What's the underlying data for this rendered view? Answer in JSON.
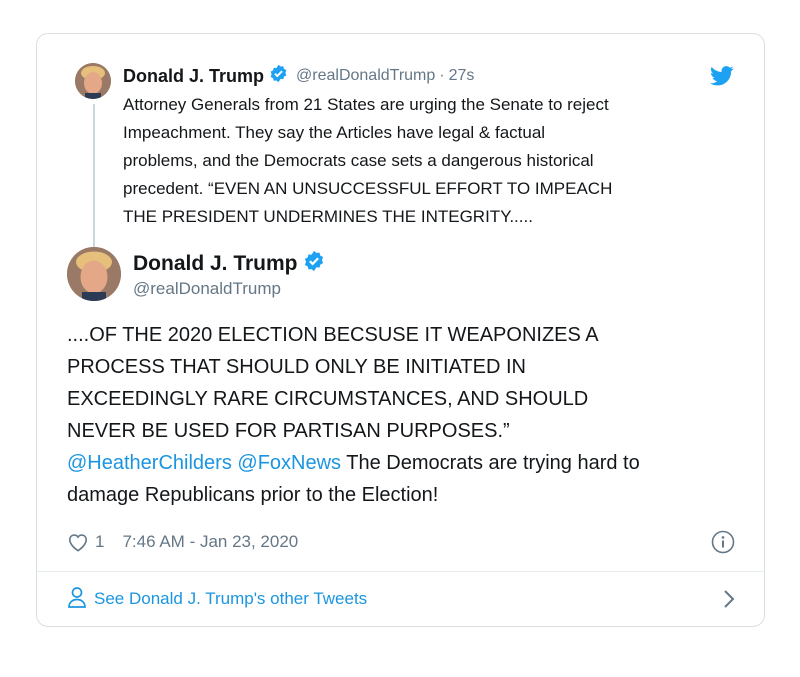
{
  "quoted_tweet": {
    "name": "Donald J. Trump",
    "handle": "@realDonaldTrump",
    "separator": "·",
    "time": "27s",
    "text_lines": [
      "Attorney Generals from 21 States are urging the Senate to reject",
      "Impeachment. They say the Articles have legal & factual",
      "problems, and the Democrats case sets a dangerous historical",
      "precedent. “EVEN AN UNSUCCESSFUL EFFORT TO IMPEACH",
      "THE PRESIDENT UNDERMINES THE INTEGRITY....."
    ]
  },
  "main_tweet": {
    "name": "Donald J. Trump",
    "handle": "@realDonaldTrump",
    "text_lines": [
      "....OF THE 2020 ELECTION BECSUSE IT WEAPONIZES A",
      "PROCESS THAT SHOULD ONLY BE INITIATED IN",
      "EXCEEDINGLY RARE CIRCUMSTANCES, AND SHOULD",
      "NEVER BE USED FOR PARTISAN PURPOSES.”"
    ],
    "mention_1": "@HeatherChilders",
    "mention_2": "@FoxNews",
    "line5_rest": "The Democrats are trying hard to",
    "line6": "damage Republicans prior to the Election!",
    "like_count": "1",
    "timestamp": "7:46 AM - Jan 23, 2020"
  },
  "footer": {
    "label": "See Donald J. Trump's other Tweets"
  },
  "icons": {
    "verified": "verified-badge-icon",
    "bird": "twitter-bird-icon",
    "heart": "heart-icon",
    "info": "info-icon",
    "person": "person-icon",
    "chevron": "chevron-right-icon"
  },
  "colors": {
    "brand_blue": "#1da1f2",
    "link_blue": "#1b95e0",
    "muted_gray": "#657786",
    "text": "#14171a"
  }
}
